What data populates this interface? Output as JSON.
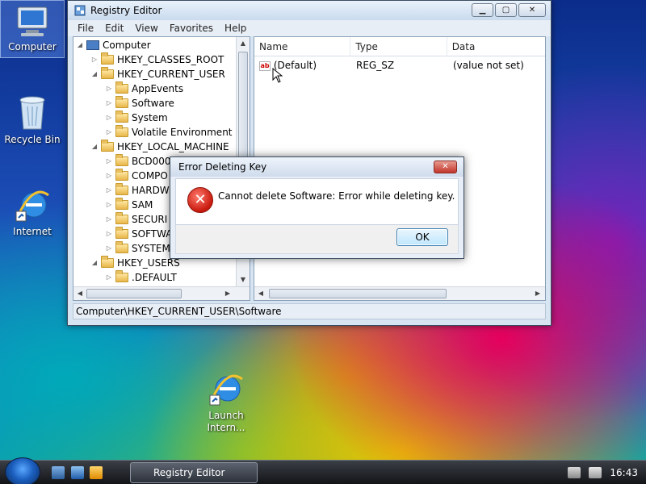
{
  "desktop": {
    "icons": [
      {
        "label": "Computer"
      },
      {
        "label": "Recycle Bin"
      },
      {
        "label": "Internet"
      },
      {
        "label": "Launch Intern..."
      }
    ]
  },
  "window": {
    "title": "Registry Editor",
    "menu": [
      "File",
      "Edit",
      "View",
      "Favorites",
      "Help"
    ],
    "tree": [
      {
        "label": "Computer",
        "depth": 0,
        "kind": "computer"
      },
      {
        "label": "HKEY_CLASSES_ROOT",
        "depth": 1,
        "kind": "folder"
      },
      {
        "label": "HKEY_CURRENT_USER",
        "depth": 1,
        "kind": "folder"
      },
      {
        "label": "AppEvents",
        "depth": 2,
        "kind": "folder"
      },
      {
        "label": "Software",
        "depth": 2,
        "kind": "folder"
      },
      {
        "label": "System",
        "depth": 2,
        "kind": "folder"
      },
      {
        "label": "Volatile Environment",
        "depth": 2,
        "kind": "folder"
      },
      {
        "label": "HKEY_LOCAL_MACHINE",
        "depth": 1,
        "kind": "folder"
      },
      {
        "label": "BCD0000",
        "depth": 2,
        "kind": "folder"
      },
      {
        "label": "COMPO",
        "depth": 2,
        "kind": "folder"
      },
      {
        "label": "HARDW",
        "depth": 2,
        "kind": "folder"
      },
      {
        "label": "SAM",
        "depth": 2,
        "kind": "folder"
      },
      {
        "label": "SECURI",
        "depth": 2,
        "kind": "folder"
      },
      {
        "label": "SOFTWA",
        "depth": 2,
        "kind": "folder"
      },
      {
        "label": "SYSTEM",
        "depth": 2,
        "kind": "folder"
      },
      {
        "label": "HKEY_USERS",
        "depth": 1,
        "kind": "folder"
      },
      {
        "label": ".DEFAULT",
        "depth": 2,
        "kind": "folder"
      }
    ],
    "list": {
      "columns": [
        "Name",
        "Type",
        "Data"
      ],
      "rows": [
        {
          "name": "(Default)",
          "type": "REG_SZ",
          "data": "(value not set)"
        }
      ]
    },
    "status_path": "Computer\\HKEY_CURRENT_USER\\Software"
  },
  "dialog": {
    "title": "Error Deleting Key",
    "message": "Cannot delete Software:  Error while deleting key.",
    "ok_label": "OK",
    "icon": "error-x-icon"
  },
  "taskbar": {
    "task_label": "Registry Editor",
    "clock": "16:43"
  },
  "colors": {
    "error": "#c8190d",
    "accent": "#3c7fb1"
  }
}
